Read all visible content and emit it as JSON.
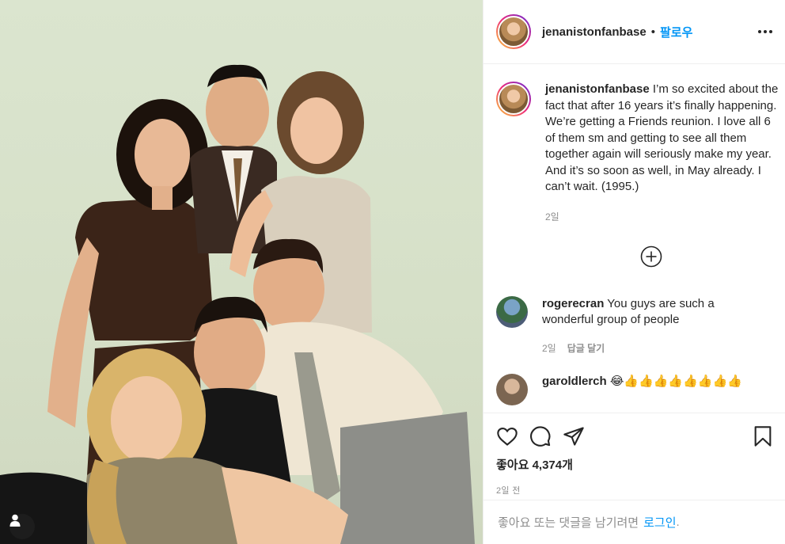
{
  "post": {
    "username": "jenanistonfanbase",
    "separator": "•",
    "follow_label": "팔로우",
    "caption": "I’m so excited about the fact that after 16 years it’s finally happening. We’re getting a Friends reunion. I love all 6 of them sm and getting to see all them together again will seriously make my year. And it’s so soon as well, in May already. I can’t wait. (1995.)",
    "caption_age": "2일"
  },
  "comments": [
    {
      "username": "rogerecran",
      "text": "You guys are such a wonderful group of people",
      "age": "2일",
      "reply_label": "답글 달기"
    },
    {
      "username": "garoldlerch",
      "text": "😂👍👍👍👍👍👍👍👍"
    }
  ],
  "actions": {
    "likes_label": "좋아요 4,374개",
    "time_label": "2일 전"
  },
  "login_prompt": {
    "text": "좋아요 또는 댓글을 남기려면",
    "link": "로그인",
    "suffix": "."
  },
  "icons": [
    "heart-icon",
    "comment-icon",
    "share-icon",
    "bookmark-icon",
    "more-icon",
    "add-comment-icon",
    "user-tag-icon"
  ],
  "colors": {
    "accent": "#0095f6",
    "text": "#262626",
    "muted": "#8e8e8e",
    "divider": "#efefef"
  }
}
